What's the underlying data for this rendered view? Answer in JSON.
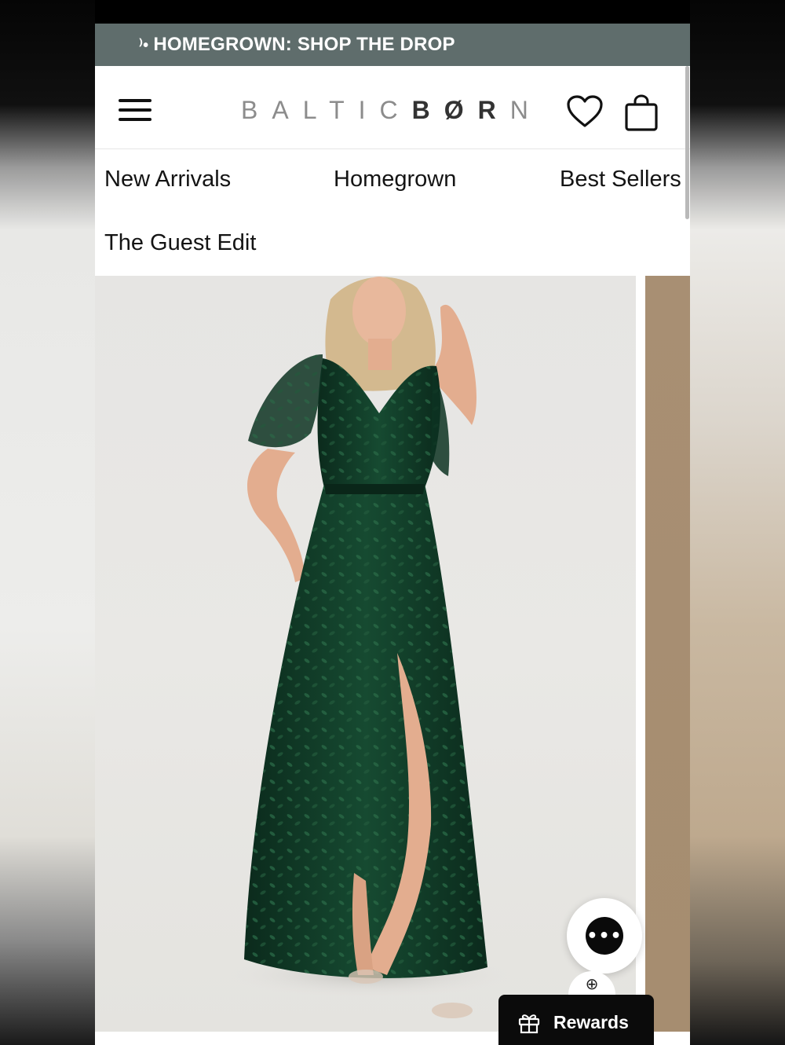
{
  "announcement": {
    "marker": "⁾•",
    "text": "HOMEGROWN: SHOP THE DROP"
  },
  "header": {
    "logo_light_1": "BALTIC",
    "logo_dark": "BØR",
    "logo_light_2": "N",
    "menu_icon": "hamburger-menu-icon",
    "wishlist_icon": "heart-icon",
    "cart_icon": "shopping-bag-icon"
  },
  "nav": {
    "items": [
      "New Arrivals",
      "Homegrown",
      "Best Sellers",
      "The Guest Edit"
    ]
  },
  "product": {
    "image_description": "Model in emerald green lace wrap maxi dress with flutter sleeves and front slit"
  },
  "widgets": {
    "chat_icon": "chat-bubble-icon",
    "chat_glyph": "•••",
    "zoom_icon": "zoom-in-icon",
    "zoom_glyph": "⊕",
    "rewards_label": "Rewards",
    "rewards_icon": "gift-icon"
  },
  "colors": {
    "announcement_bg": "#5f6d6c",
    "dress_green": "#0f3a27",
    "rewards_bg": "#0b0b0b"
  }
}
